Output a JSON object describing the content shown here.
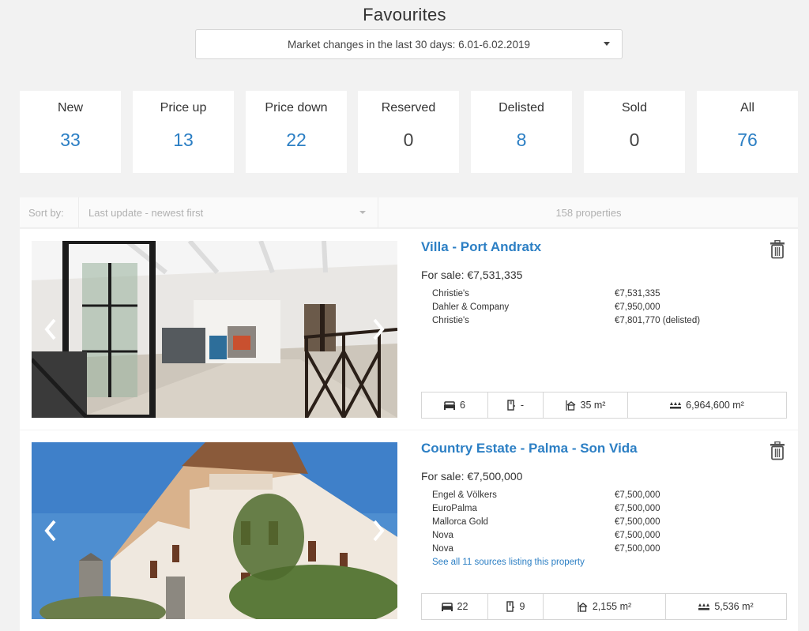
{
  "page": {
    "title": "Favourites",
    "market_filter": "Market changes in the last 30 days: 6.01-6.02.2019"
  },
  "stats": [
    {
      "label": "New",
      "count": "33"
    },
    {
      "label": "Price up",
      "count": "13"
    },
    {
      "label": "Price down",
      "count": "22"
    },
    {
      "label": "Reserved",
      "count": "0"
    },
    {
      "label": "Delisted",
      "count": "8"
    },
    {
      "label": "Sold",
      "count": "0"
    },
    {
      "label": "All",
      "count": "76"
    }
  ],
  "sort": {
    "label": "Sort by:",
    "value": "Last update - newest first",
    "count_text": "158 properties"
  },
  "listings": [
    {
      "title": "Villa - Port Andratx",
      "for_sale": "For sale: €7,531,335",
      "sources": [
        {
          "name": "Christie's",
          "price": "€7,531,335"
        },
        {
          "name": "Dahler & Company",
          "price": "€7,950,000"
        },
        {
          "name": "Christie's",
          "price": "€7,801,770 (delisted)"
        }
      ],
      "see_all": "",
      "features": {
        "bedrooms": "6",
        "bathrooms": "-",
        "built_area": "35 m²",
        "plot_area": "6,964,600 m²"
      }
    },
    {
      "title": "Country Estate - Palma - Son Vida",
      "for_sale": "For sale: €7,500,000",
      "sources": [
        {
          "name": "Engel & Völkers",
          "price": "€7,500,000"
        },
        {
          "name": "EuroPalma",
          "price": "€7,500,000"
        },
        {
          "name": "Mallorca Gold",
          "price": "€7,500,000"
        },
        {
          "name": "Nova",
          "price": "€7,500,000"
        },
        {
          "name": "Nova",
          "price": "€7,500,000"
        }
      ],
      "see_all": "See all 11 sources listing this property",
      "features": {
        "bedrooms": "22",
        "bathrooms": "9",
        "built_area": "2,155 m²",
        "plot_area": "5,536 m²"
      }
    }
  ],
  "icons": {
    "bed": "bed-icon",
    "bath": "bath-icon",
    "built": "house-icon",
    "plot": "plot-icon",
    "trash": "trash-icon",
    "prev": "chevron-left-icon",
    "next": "chevron-right-icon"
  },
  "colors": {
    "accent": "#2c7fc4",
    "background": "#f2f2f2"
  }
}
